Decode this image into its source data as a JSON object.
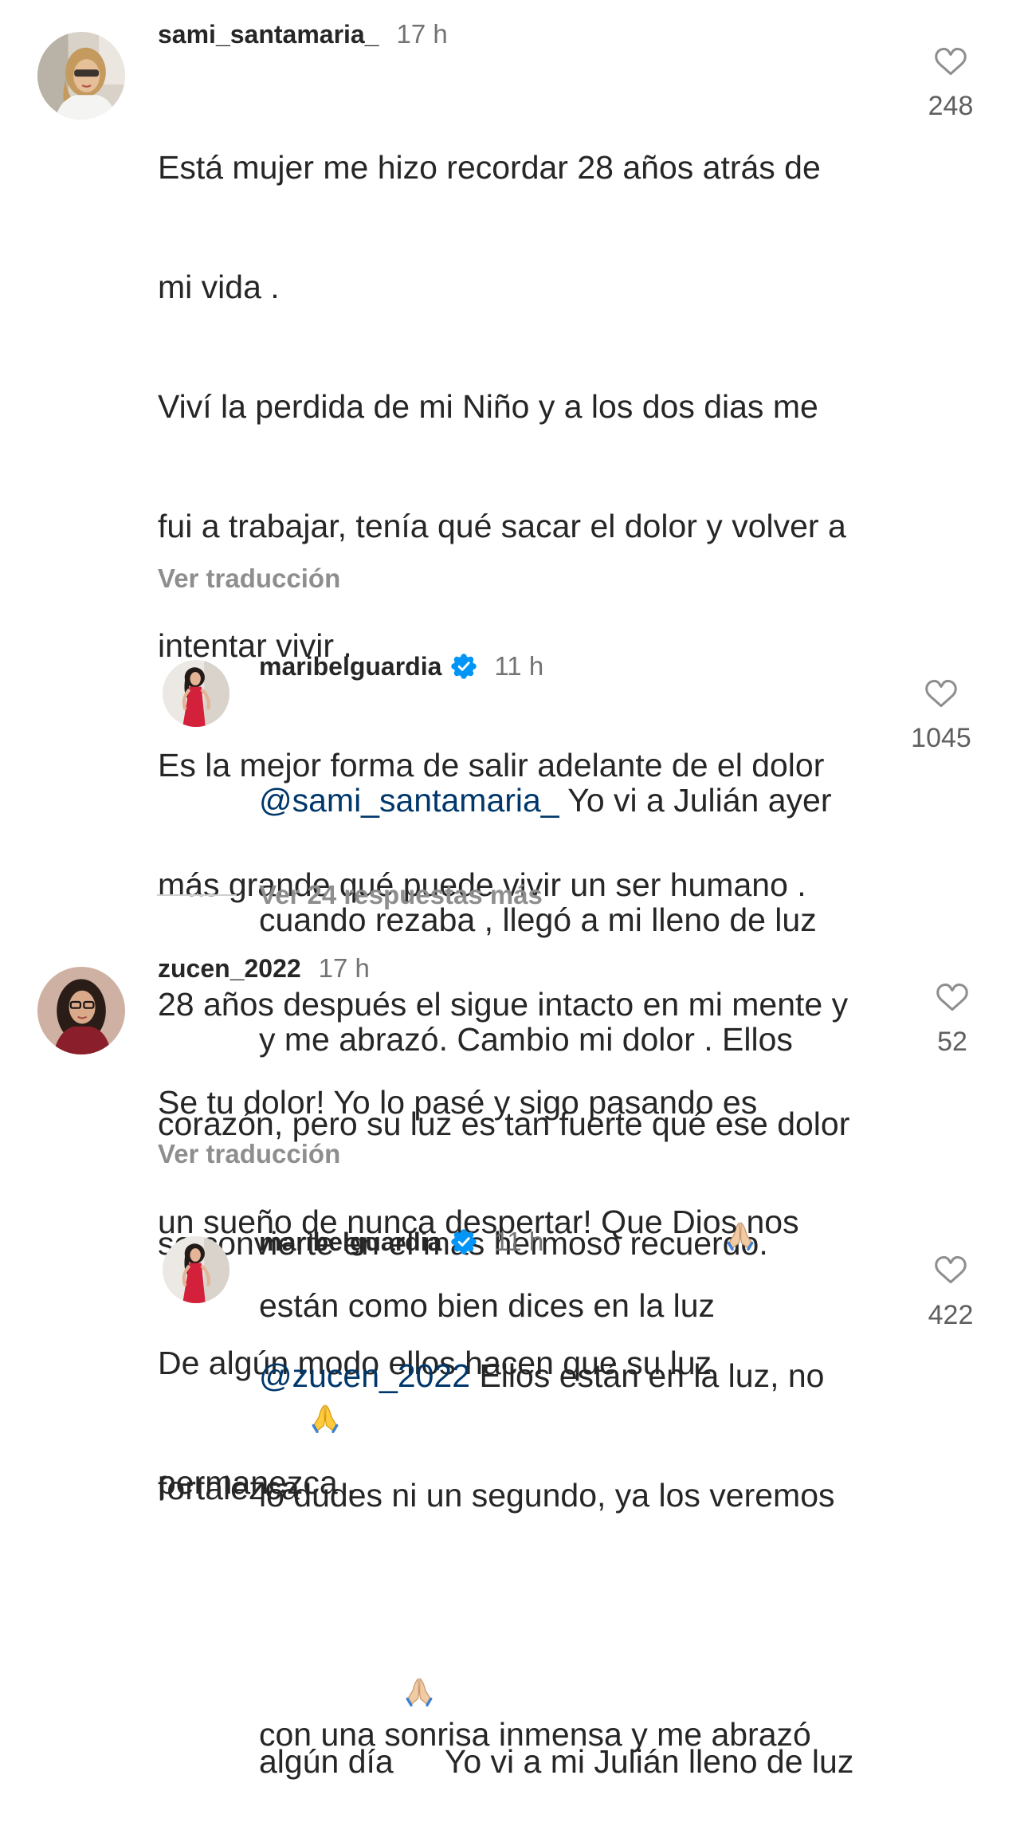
{
  "colors": {
    "text": "#262626",
    "muted": "#737373",
    "mention": "#00376b",
    "verified": "#0095f6"
  },
  "icons": {
    "like": "heart-outline-icon",
    "verified": "verified-badge-icon",
    "emoji": "praying-hands-emoji"
  },
  "comments": [
    {
      "username": "sami_santamaria_",
      "time": "17 h",
      "body": [
        {
          "text": "Está mujer me hizo recordar 28 años atrás de"
        },
        {
          "text": "mi vida ."
        },
        {
          "text": "Viví la perdida de mi Niño y a los dos dias me"
        },
        {
          "text": "fui a trabajar, tenía qué sacar el dolor y volver a"
        },
        {
          "text": "intentar vivir ."
        },
        {
          "text": "Es la mejor forma de salir adelante de el dolor"
        },
        {
          "text": "más grande qué puede vivir un ser humano ."
        },
        {
          "text": "28 años después el sigue intacto en mi mente y"
        },
        {
          "text": "corazón, pero su luz es tan fuerte qué ese dolor"
        },
        {
          "text": "se convierte en el más hermoso recuerdo."
        },
        {
          "text": "De algún modo ellos hacen que su luz"
        },
        {
          "text": "permanezca ."
        }
      ],
      "translate_label": "Ver traducción",
      "likes": "248",
      "reply": {
        "username": "maribelguardia",
        "verified": true,
        "time": "11 h",
        "body": [
          {
            "mention": "@sami_santamaria_",
            "text": " Yo vi a Julián ayer"
          },
          {
            "text": "cuando rezaba , llegó a mi lleno de luz"
          },
          {
            "text": "y me abrazó. Cambio mi dolor . Ellos"
          },
          {
            "text": "están como bien dices en la luz ",
            "emoji": "praying-hands-light-skin"
          }
        ],
        "likes": "1045"
      },
      "more_replies_label": "Ver 24 respuestas más"
    },
    {
      "username": "zucen_2022",
      "time": "17 h",
      "body": [
        {
          "text": "Se tu dolor! Yo lo pasé y sigo pasando es"
        },
        {
          "text": "un sueño de nunca despertar! Que Dios nos"
        },
        {
          "text": "fortalezca ",
          "emoji": "praying-hands-yellow"
        }
      ],
      "translate_label": "Ver traducción",
      "likes": "52",
      "reply": {
        "username": "maribelguardia",
        "verified": true,
        "time": "11 h",
        "body": [
          {
            "mention": "@zucen_2022",
            "text": " Ellos están en la luz, no"
          },
          {
            "text": "lo dudes ni un segundo, ya los veremos"
          },
          {
            "text": "algún día ",
            "emoji": "praying-hands-light-skin",
            "text_after": " Yo vi a mi Julián lleno de luz"
          },
          {
            "text": "con una sonrisa inmensa y me abrazó"
          }
        ],
        "likes": "422"
      }
    }
  ]
}
